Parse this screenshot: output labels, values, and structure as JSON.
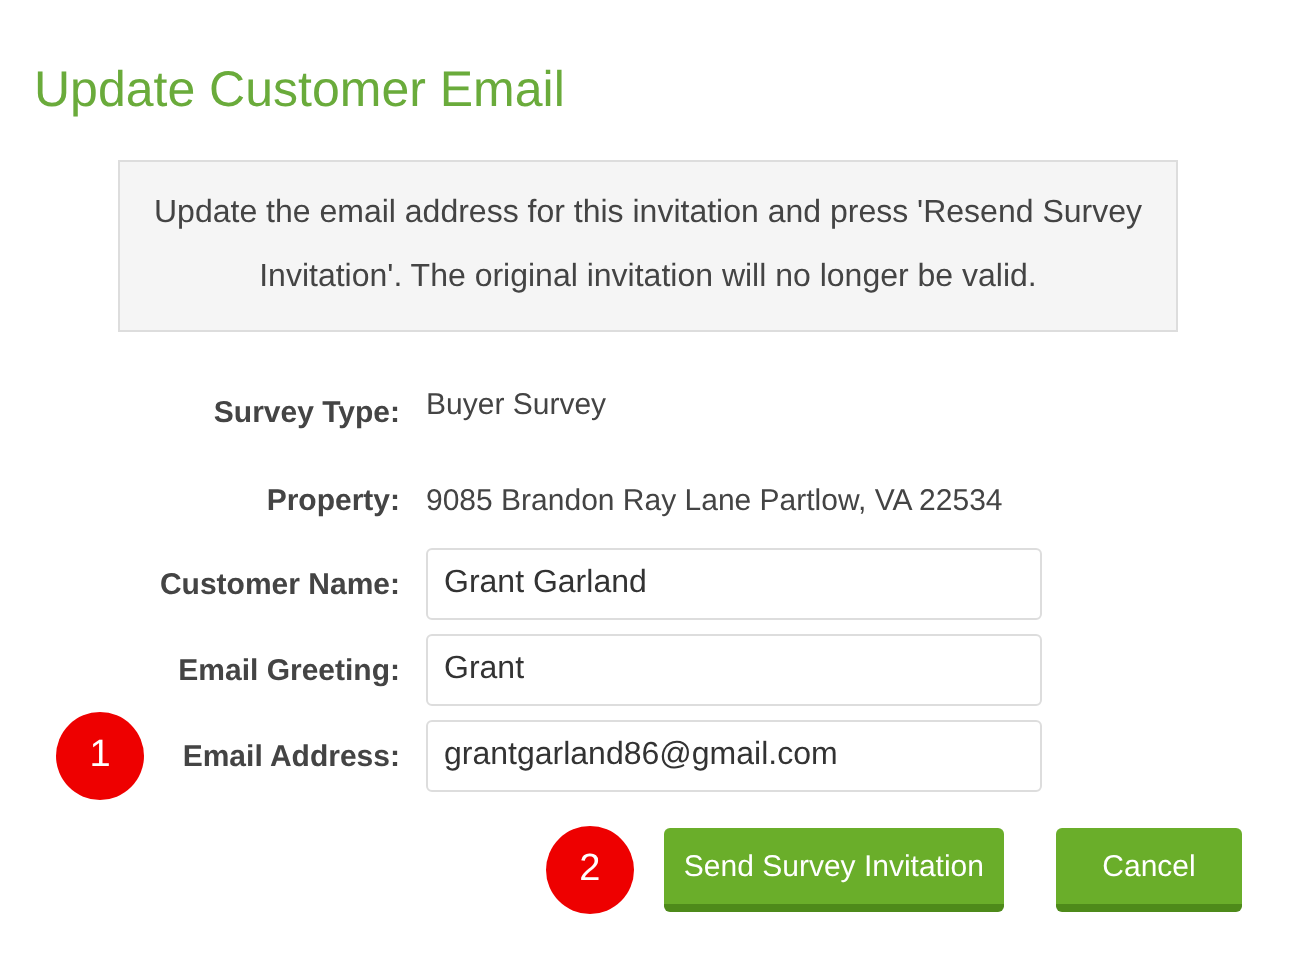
{
  "title": "Update Customer Email",
  "notice": "Update the email address for this invitation and press 'Resend Survey Invitation'. The original invitation will no longer be valid.",
  "details": [
    {
      "label": "Survey Type:",
      "value": "Buyer Survey"
    },
    {
      "label": "Property:",
      "value": "9085 Brandon Ray Lane Partlow, VA 22534"
    }
  ],
  "fields": [
    {
      "label": "Customer Name:",
      "value": "Grant Garland"
    },
    {
      "label": "Email Greeting:",
      "value": "Grant"
    },
    {
      "label": "Email Address:",
      "value": "grantgarland86@gmail.com",
      "callout": "1"
    }
  ],
  "buttons": [
    {
      "label": "Send Survey Invitation",
      "callout": "2"
    },
    {
      "label": "Cancel"
    }
  ]
}
